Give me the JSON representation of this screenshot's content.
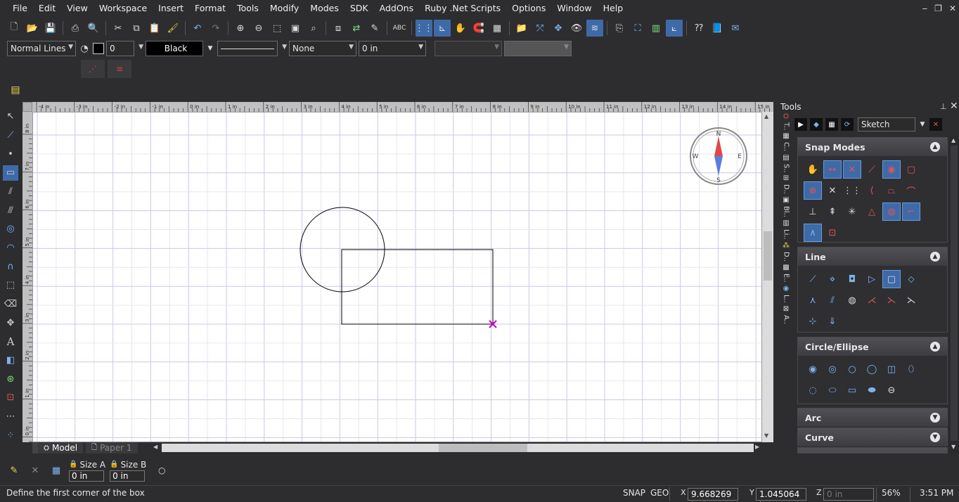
{
  "menu": [
    "File",
    "Edit",
    "View",
    "Workspace",
    "Insert",
    "Format",
    "Tools",
    "Modify",
    "Modes",
    "SDK",
    "AddOns",
    "Ruby .Net Scripts",
    "Options",
    "Window",
    "Help"
  ],
  "window_controls": [
    "‒",
    "❐",
    "✕"
  ],
  "properties_bar": {
    "line_style": "Normal Lines",
    "pen_width": "0",
    "color": "Black",
    "pattern": "None",
    "thickness": "0 in"
  },
  "ruler_top_labels": [
    "-4 in",
    "-3 in",
    "-2 in",
    "-1 in",
    "0 in",
    "1 in",
    "2 in",
    "3 in",
    "4 in",
    "5 in",
    "6 in",
    "7 in",
    "8 in",
    "9 in",
    "10 in",
    "11 in",
    "12 in",
    "13 in",
    "14 in",
    "15 in"
  ],
  "ruler_left_labels": [
    "8 in",
    "7 in",
    "6 in",
    "5 in",
    "4 in",
    "3 in",
    "2 in",
    "1 in",
    "0 in"
  ],
  "compass": {
    "n": "N",
    "s": "S",
    "e": "E",
    "w": "W"
  },
  "sheet_tabs": {
    "model": "Model",
    "paper": "Paper 1"
  },
  "tools_palette": {
    "title": "Tools",
    "mode": "Sketch",
    "side_strip": [
      "T..",
      "C..",
      "S..",
      "D..",
      "Bl..",
      "Li..",
      "D..",
      "E..",
      "L..",
      "A.."
    ],
    "panels": {
      "snap": "Snap Modes",
      "line": "Line",
      "circle": "Circle/Ellipse",
      "arc": "Arc",
      "curve": "Curve"
    }
  },
  "bottom": {
    "size_a_label": "Size A",
    "size_a_value": "0 in",
    "size_b_label": "Size B",
    "size_b_value": "0 in"
  },
  "status": {
    "message": "Define the first corner of the box",
    "snap": "SNAP",
    "geo": "GEO",
    "x_label": "X",
    "x_value": "9.668269 in",
    "y_label": "Y",
    "y_value": "1.045064 in",
    "z_label": "Z",
    "z_value": "0 in",
    "zoom": "56%",
    "time": "3:51 PM"
  }
}
